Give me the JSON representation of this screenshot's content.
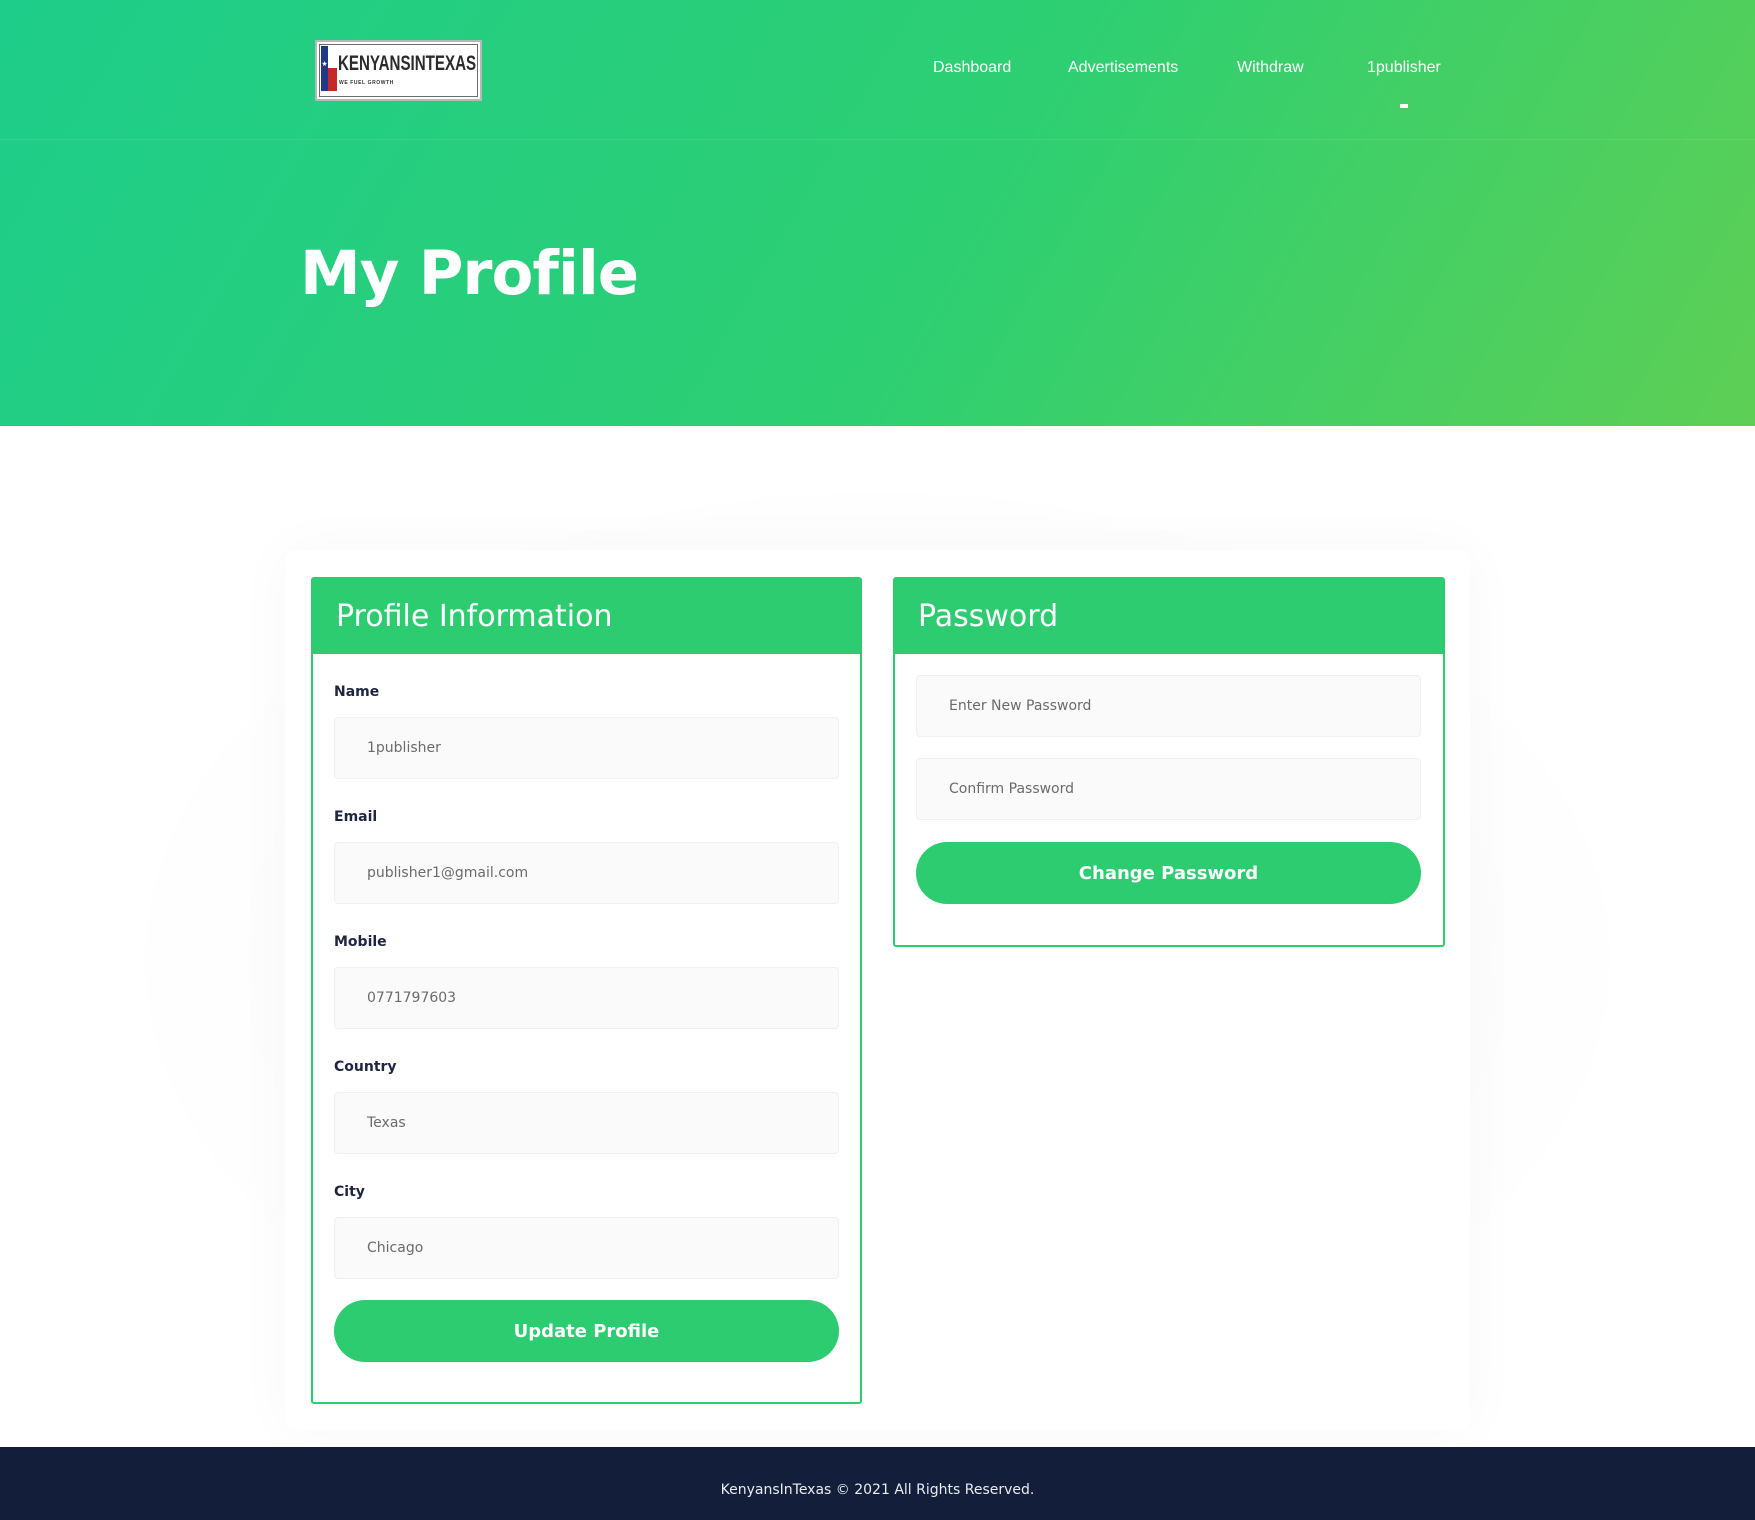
{
  "brand": {
    "logo_text": "KENYANSINTEXAS",
    "logo_tagline": "WE FUEL GROWTH"
  },
  "nav": {
    "items": [
      {
        "label": "Dashboard"
      },
      {
        "label": "Advertisements"
      },
      {
        "label": "Withdraw"
      },
      {
        "label": "1publisher"
      }
    ]
  },
  "page": {
    "title": "My Profile"
  },
  "profile": {
    "title": "Profile Information",
    "fields": [
      {
        "label": "Name",
        "value": "1publisher"
      },
      {
        "label": "Email",
        "value": "publisher1@gmail.com"
      },
      {
        "label": "Mobile",
        "value": "0771797603"
      },
      {
        "label": "Country",
        "value": "Texas"
      },
      {
        "label": "City",
        "value": "Chicago"
      }
    ],
    "submit_label": "Update Profile"
  },
  "password": {
    "title": "Password",
    "new_placeholder": "Enter New Password",
    "confirm_placeholder": "Confirm Password",
    "submit_label": "Change Password"
  },
  "footer": {
    "text": "KenyansInTexas © 2021 All Rights Reserved."
  },
  "colors": {
    "accent": "#2ecc71",
    "hero_start": "#1ecd8a",
    "hero_end": "#5ecf55",
    "footer_bg": "#131f3a"
  }
}
